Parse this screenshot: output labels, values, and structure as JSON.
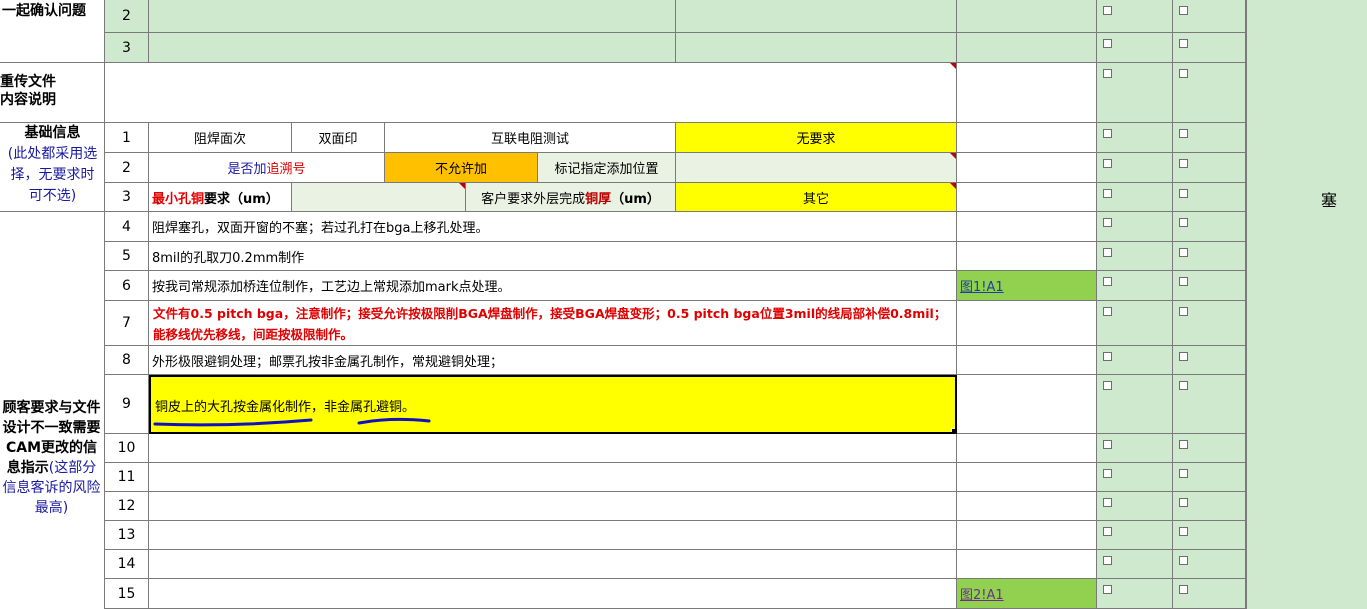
{
  "sections": {
    "confirm": "一起确认问题",
    "reupload_line1": "重传文件",
    "reupload_line2": "内容说明",
    "basic_title": "基础信息",
    "basic_note": "(此处都采用选择，无要求时可不选)",
    "customer_line1": "顾客要求与文件设计不一致需要CAM更改的信息指示",
    "customer_note": "(这部分信息客诉的风险最高)"
  },
  "confirm_rows": [
    {
      "num": "2"
    },
    {
      "num": "3"
    }
  ],
  "basic_rows": {
    "r1": {
      "num": "1",
      "a": "阻焊面次",
      "b": "双面印",
      "c": "互联电阻测试",
      "d": "无要求"
    },
    "r2": {
      "num": "2",
      "a_prefix": "是否加",
      "a_red": "追溯号",
      "b": "不允许加",
      "c": "标记指定添加位置"
    },
    "r3": {
      "num": "3",
      "a_red": "最小孔铜",
      "a_suffix": "要求（um）",
      "c_prefix": "客户要求外层完成",
      "c_red": "铜厚",
      "c_suffix": "（um）",
      "d": "其它"
    }
  },
  "instruction_rows": [
    {
      "num": "4",
      "text": "阻焊塞孔，双面开窗的不塞；若过孔打在bga上移孔处理。"
    },
    {
      "num": "5",
      "text": "8mil的孔取刀0.2mm制作"
    },
    {
      "num": "6",
      "text": "按我司常规添加桥连位制作，工艺边上常规添加mark点处理。",
      "link": "图1!A1"
    },
    {
      "num": "7",
      "text": "文件有0.5 pitch bga，注意制作；接受允许按极限削BGA焊盘制作，接受BGA焊盘变形；0.5 pitch bga位置3mil的线局部补偿0.8mil；能移线优先移线，间距按极限制作。"
    },
    {
      "num": "8",
      "text": "外形极限避铜处理；邮票孔按非金属孔制作，常规避铜处理；"
    },
    {
      "num": "9",
      "text": "铜皮上的大孔按金属化制作，非金属孔避铜。"
    },
    {
      "num": "10",
      "text": ""
    },
    {
      "num": "11",
      "text": ""
    },
    {
      "num": "12",
      "text": ""
    },
    {
      "num": "13",
      "text": ""
    },
    {
      "num": "14",
      "text": ""
    },
    {
      "num": "15",
      "text": "",
      "link": "图2!A1"
    }
  ],
  "right_label": "塞",
  "colors": {
    "green": "#cfe9cf",
    "yellow": "#ffff00",
    "orange": "#ffc000",
    "link_green": "#92d050",
    "annotation_blue": "#1010c0"
  }
}
